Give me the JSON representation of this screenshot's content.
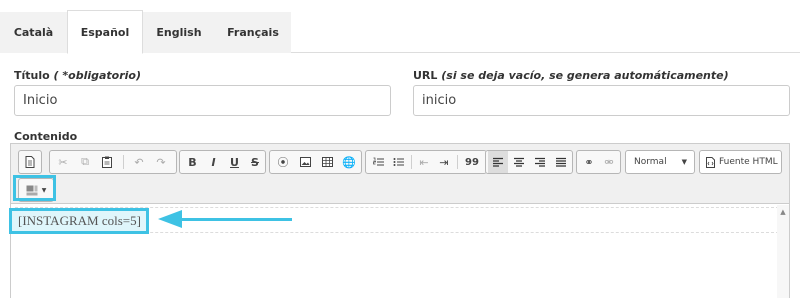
{
  "tabs": [
    {
      "label": "Català",
      "active": false
    },
    {
      "label": "Español",
      "active": true
    },
    {
      "label": "English",
      "active": false
    },
    {
      "label": "Français",
      "active": false
    }
  ],
  "form": {
    "title_label": "Título",
    "title_hint": " ( *obligatorio)",
    "title_value": "Inicio",
    "url_label": "URL",
    "url_hint": " (si se deja vacío, se genera automáticamente)",
    "url_value": "inicio",
    "content_label": "Contenido"
  },
  "toolbar": {
    "format_select": "Normal",
    "source_button": "Fuente HTML",
    "bold": "B",
    "italic": "I",
    "underline": "U",
    "strike": "S",
    "blockquote": "99"
  },
  "editor": {
    "content": "[INSTAGRAM cols=5]"
  },
  "colors": {
    "highlight": "#3ec2e4"
  }
}
